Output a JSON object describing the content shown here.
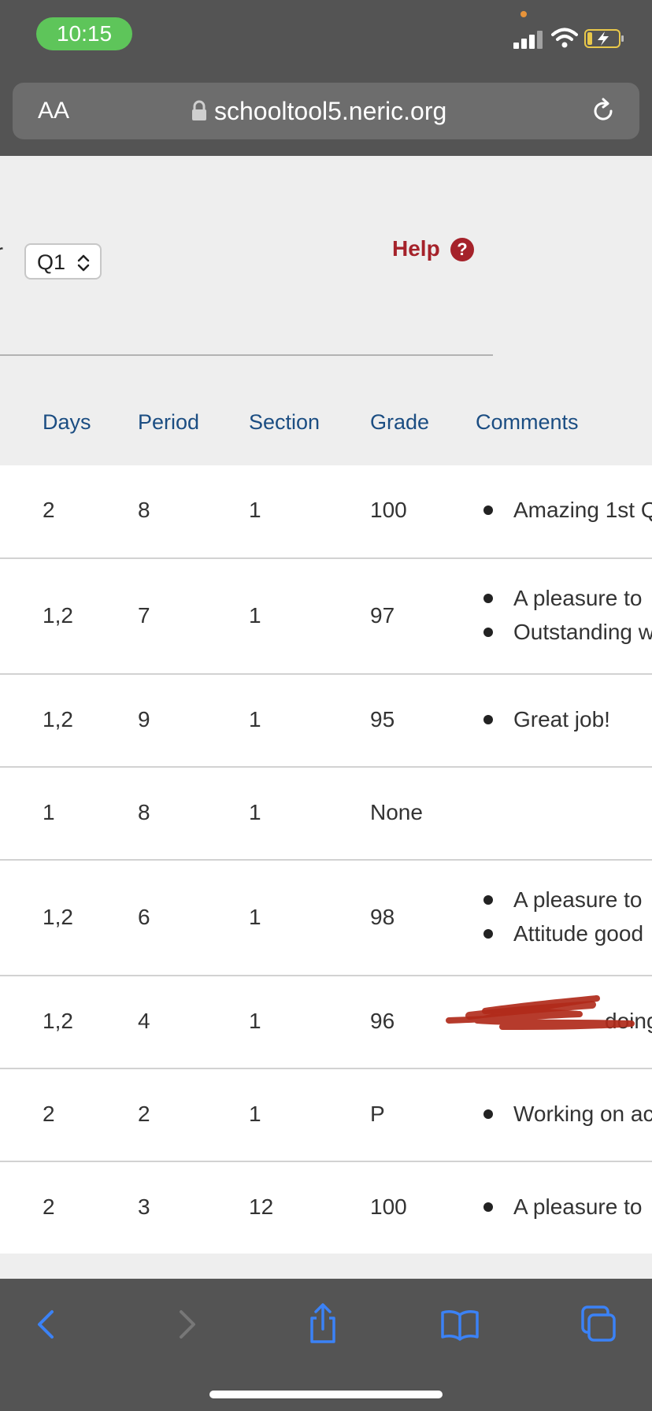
{
  "status_bar": {
    "time": "10:15"
  },
  "url_bar": {
    "aa_label": "AA",
    "url": "schooltool5.neric.org"
  },
  "controls": {
    "cut_label": "r",
    "quarter_value": "Q1",
    "help_label": "Help"
  },
  "table": {
    "headers": [
      "Days",
      "Period",
      "Section",
      "Grade",
      "Comments"
    ],
    "rows": [
      {
        "days": "2",
        "period": "8",
        "section": "1",
        "grade": "100",
        "comments": [
          "Amazing 1st Q"
        ]
      },
      {
        "days": "1,2",
        "period": "7",
        "section": "1",
        "grade": "97",
        "comments": [
          "A pleasure to",
          "Outstanding w"
        ]
      },
      {
        "days": "1,2",
        "period": "9",
        "section": "1",
        "grade": "95",
        "comments": [
          "Great job!"
        ]
      },
      {
        "days": "1",
        "period": "8",
        "section": "1",
        "grade": "None",
        "comments": []
      },
      {
        "days": "1,2",
        "period": "6",
        "section": "1",
        "grade": "98",
        "comments": [
          "A pleasure to",
          "Attitude good"
        ]
      },
      {
        "days": "1,2",
        "period": "4",
        "section": "1",
        "grade": "96",
        "comments": [
          "doing"
        ]
      },
      {
        "days": "2",
        "period": "2",
        "section": "1",
        "grade": "P",
        "comments": [
          "Working on ac"
        ]
      },
      {
        "days": "2",
        "period": "3",
        "section": "12",
        "grade": "100",
        "comments": [
          "A pleasure to"
        ]
      }
    ]
  },
  "toolbar": {
    "icons": [
      "back-icon",
      "forward-icon",
      "share-icon",
      "bookmarks-icon",
      "tabs-icon"
    ]
  },
  "colors": {
    "accent": "#a5222a",
    "header_text": "#1b4d82",
    "toolbar_icon": "#3b82f6",
    "status_green": "#5ec55a"
  }
}
